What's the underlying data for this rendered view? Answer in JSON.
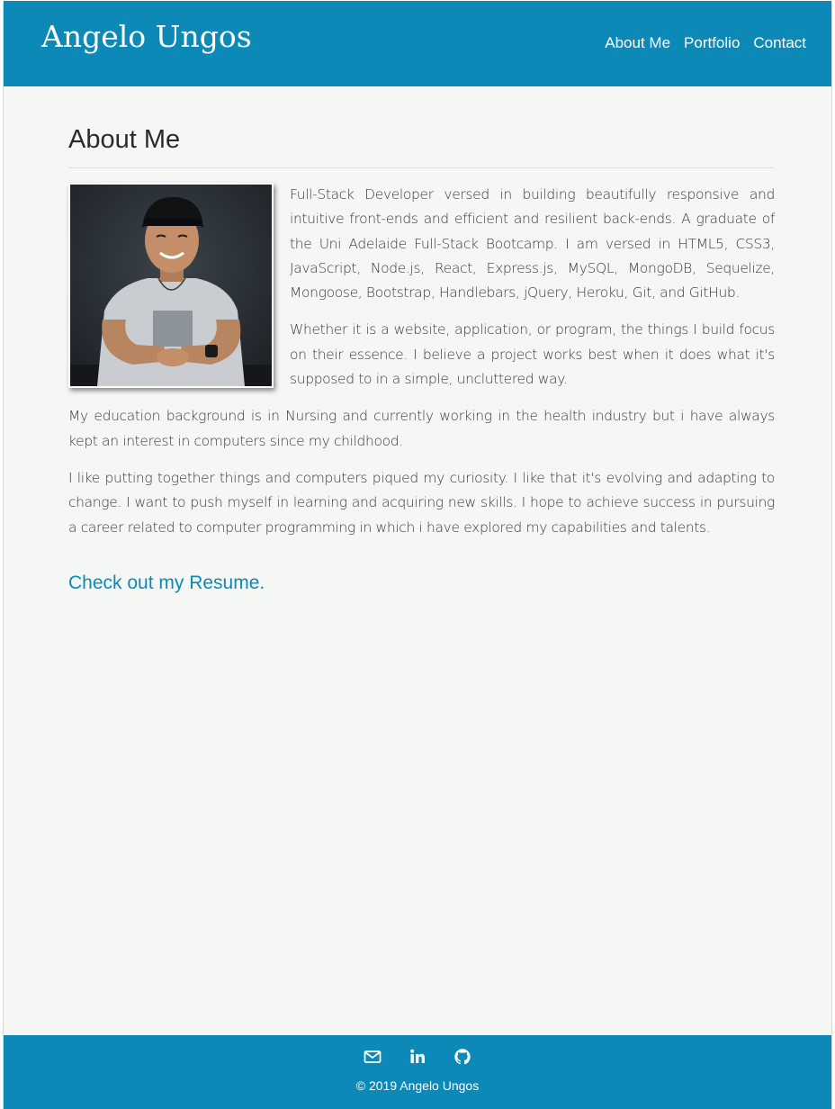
{
  "header": {
    "brand": "Angelo Ungos",
    "nav": [
      {
        "label": "About Me"
      },
      {
        "label": "Portfolio"
      },
      {
        "label": "Contact"
      }
    ]
  },
  "main": {
    "title": "About Me",
    "paragraphs": [
      "Full-Stack Developer versed in building beautifully responsive and intuitive front-ends and efficient and resilient back-ends. A graduate of the Uni Adelaide Full-Stack Bootcamp. I am versed in HTML5, CSS3, JavaScript, Node.js, React, Express.js, MySQL, MongoDB, Sequelize, Mongoose, Bootstrap, Handlebars, jQuery, Heroku, Git, and GitHub.",
      "Whether it is a website, application, or program, the things I build focus on their essence. I believe a project works best when it does what it's supposed to in a simple, uncluttered way.",
      "My education background is in Nursing and currently working in the health industry but i have always kept an interest in computers since my childhood.",
      "I like putting together things and computers piqued my curiosity. I like that it's evolving and adapting to change. I want to push myself in learning and acquiring new skills. I hope to achieve success in pursuing a career related to computer programming in which i have explored my capabilities and talents."
    ],
    "resume_link": "Check out my Resume."
  },
  "footer": {
    "icons": [
      "envelope-icon",
      "linkedin-icon",
      "github-icon"
    ],
    "copyright": "© 2019 Angelo Ungos"
  },
  "colors": {
    "brand_blue": "#0d89b8",
    "page_background": "#f5f7f4",
    "text": "#3a3a3a"
  }
}
